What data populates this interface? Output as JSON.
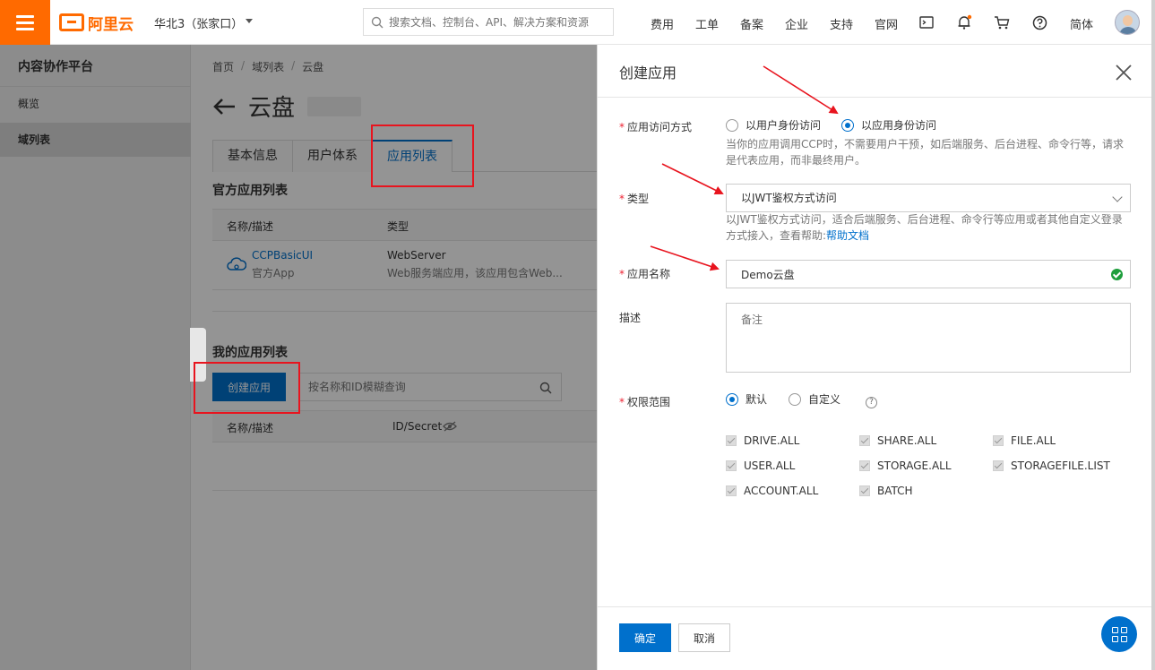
{
  "topbar": {
    "logo_text": "阿里云",
    "region": "华北3（张家口）",
    "search_placeholder": "搜索文档、控制台、API、解决方案和资源",
    "nav": [
      "费用",
      "工单",
      "备案",
      "企业",
      "支持",
      "官网"
    ],
    "lang": "简体",
    "accent_color": "#ff6a00"
  },
  "sidebar": {
    "title": "内容协作平台",
    "items": [
      {
        "label": "概览",
        "active": false
      },
      {
        "label": "域列表",
        "active": true
      }
    ]
  },
  "main": {
    "breadcrumb": [
      "首页",
      "域列表",
      "云盘"
    ],
    "breadcrumb_sep": "/",
    "page_title": "云盘",
    "tabs": [
      {
        "label": "基本信息",
        "active": false
      },
      {
        "label": "用户体系",
        "active": false
      },
      {
        "label": "应用列表",
        "active": true
      }
    ],
    "official_section_title": "官方应用列表",
    "official_columns": [
      "名称/描述",
      "类型"
    ],
    "official_apps": [
      {
        "name": "CCPBasicUI",
        "subtitle": "官方App",
        "type": "WebServer",
        "description": "Web服务端应用，该应用包含Web..."
      }
    ],
    "my_section_title": "我的应用列表",
    "create_button": "创建应用",
    "filter_placeholder": "按名称和ID模糊查询",
    "my_columns": [
      "名称/描述",
      "ID/Secret"
    ]
  },
  "drawer": {
    "title": "创建应用",
    "access_mode": {
      "label": "应用访问方式",
      "options": [
        {
          "label": "以用户身份访问",
          "selected": false
        },
        {
          "label": "以应用身份访问",
          "selected": true
        }
      ],
      "help": "当你的应用调用CCP时，不需要用户干预，如后端服务、后台进程、命令行等，请求是代表应用，而非最终用户。"
    },
    "type": {
      "label": "类型",
      "value": "以JWT鉴权方式访问",
      "help": "以JWT鉴权方式访问，适合后端服务、后台进程、命令行等应用或者其他自定义登录方式接入，查看帮助:",
      "help_link": "帮助文档"
    },
    "app_name": {
      "label": "应用名称",
      "value": "Demo云盘"
    },
    "description": {
      "label": "描述",
      "placeholder": "备注"
    },
    "scope": {
      "label": "权限范围",
      "options": [
        {
          "label": "默认",
          "selected": true
        },
        {
          "label": "自定义",
          "selected": false
        }
      ],
      "help_mark": "?",
      "permissions": [
        "DRIVE.ALL",
        "SHARE.ALL",
        "FILE.ALL",
        "USER.ALL",
        "STORAGE.ALL",
        "STORAGEFILE.LIST",
        "ACCOUNT.ALL",
        "BATCH"
      ]
    },
    "confirm_button": "确定",
    "cancel_button": "取消",
    "primary_color": "#0070cc"
  },
  "annotations": {
    "highlight_color": "#e8141e"
  }
}
